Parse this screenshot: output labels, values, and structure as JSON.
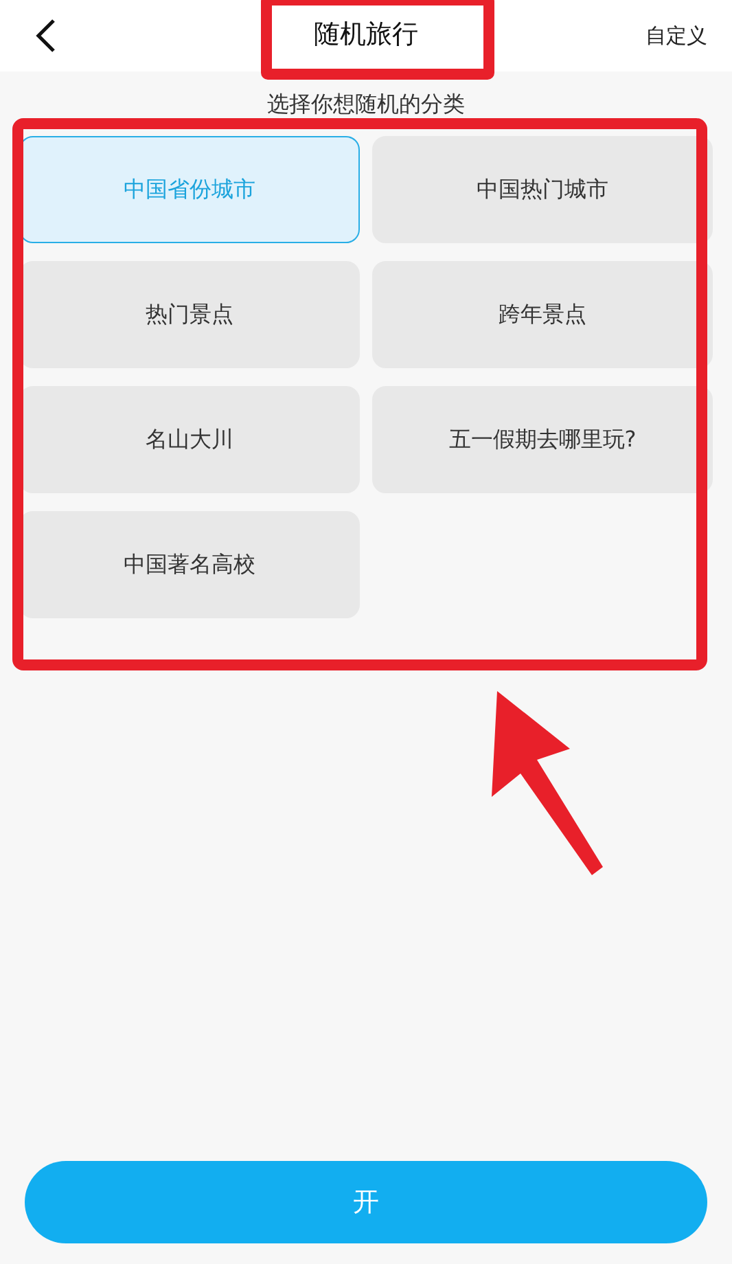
{
  "header": {
    "title": "随机旅行",
    "action": "自定义"
  },
  "prompt": "选择你想随机的分类",
  "categories": [
    {
      "label": "中国省份城市",
      "selected": true
    },
    {
      "label": "中国热门城市",
      "selected": false
    },
    {
      "label": "热门景点",
      "selected": false
    },
    {
      "label": "跨年景点",
      "selected": false
    },
    {
      "label": "名山大川",
      "selected": false
    },
    {
      "label": "五一假期去哪里玩?",
      "selected": false
    },
    {
      "label": "中国著名高校",
      "selected": false
    }
  ],
  "start_button": "开"
}
